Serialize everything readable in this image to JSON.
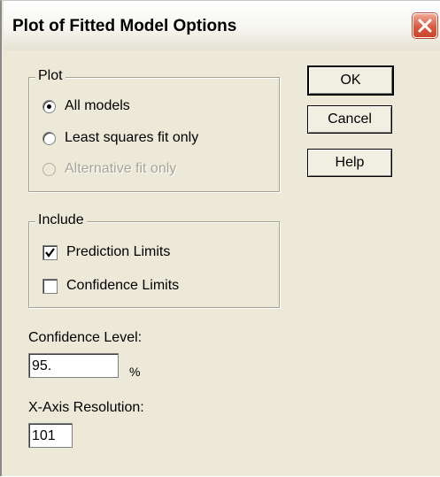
{
  "dialog": {
    "title": "Plot of Fitted Model Options"
  },
  "plot_group": {
    "legend": "Plot",
    "options": [
      {
        "label": "All models",
        "selected": true,
        "enabled": true
      },
      {
        "label": "Least squares fit only",
        "selected": false,
        "enabled": true
      },
      {
        "label": "Alternative fit only",
        "selected": false,
        "enabled": false
      }
    ]
  },
  "include_group": {
    "legend": "Include",
    "checks": [
      {
        "label": "Prediction Limits",
        "checked": true
      },
      {
        "label": "Confidence Limits",
        "checked": false
      }
    ]
  },
  "buttons": {
    "ok": "OK",
    "cancel": "Cancel",
    "help": "Help"
  },
  "confidence": {
    "label": "Confidence Level:",
    "value": "95.",
    "unit": "%"
  },
  "resolution": {
    "label": "X-Axis Resolution:",
    "value": "101"
  },
  "colors": {
    "titlebar": "#f6f5ef",
    "dialog_bg": "#ece9d8",
    "close_btn": "#d8553c"
  }
}
